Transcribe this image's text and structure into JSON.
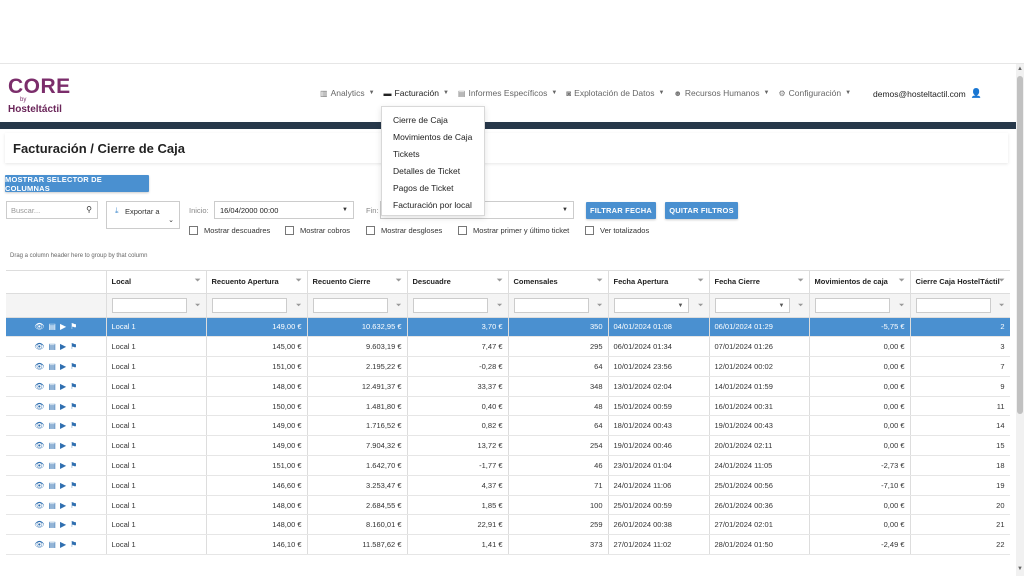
{
  "logo": {
    "line1": "CORE",
    "line2": "by",
    "line3": "Hosteltáctil"
  },
  "nav": [
    {
      "label": "Analytics",
      "icon": "chart-icon"
    },
    {
      "label": "Facturación",
      "icon": "card-icon"
    },
    {
      "label": "Informes Específicos",
      "icon": "report-icon"
    },
    {
      "label": "Explotación de Datos",
      "icon": "database-icon"
    },
    {
      "label": "Recursos Humanos",
      "icon": "users-icon"
    },
    {
      "label": "Configuración",
      "icon": "gear-icon"
    }
  ],
  "user": {
    "email": "demos@hosteltactil.com",
    "icon": "user-icon"
  },
  "dropdown": [
    "Cierre de Caja",
    "Movimientos de Caja",
    "Tickets",
    "Detalles de Ticket",
    "Pagos de Ticket",
    "Facturación por local"
  ],
  "page": {
    "title": "Facturación / Cierre de Caja"
  },
  "toolbar": {
    "columns_btn": "MOSTRAR SELECTOR DE COLUMNAS",
    "search_placeholder": "Buscar...",
    "export_label": "Exportar a",
    "inicio_label": "Inicio:",
    "inicio_value": "16/04/2000 00:00",
    "fin_label": "Fin:",
    "filter_btn": "FILTRAR FECHA",
    "clear_btn": "QUITAR FILTROS"
  },
  "checks": [
    "Mostrar descuadres",
    "Mostrar cobros",
    "Mostrar desgloses",
    "Mostrar primer y último ticket",
    "Ver totalizados"
  ],
  "drag_hint": "Drag a column header here to group by that column",
  "columns": [
    "Local",
    "Recuento Apertura",
    "Recuento Cierre",
    "Descuadre",
    "Comensales",
    "Fecha Apertura",
    "Fecha Cierre",
    "Movimientos de caja",
    "Cierre Caja HostelTáctil"
  ],
  "rows": [
    [
      "Local 1",
      "149,00 €",
      "10.632,95 €",
      "3,70 €",
      "350",
      "04/01/2024 01:08",
      "06/01/2024 01:29",
      "-5,75 €",
      "2"
    ],
    [
      "Local 1",
      "145,00 €",
      "9.603,19 €",
      "7,47 €",
      "295",
      "06/01/2024 01:34",
      "07/01/2024 01:26",
      "0,00 €",
      "3"
    ],
    [
      "Local 1",
      "151,00 €",
      "2.195,22 €",
      "-0,28 €",
      "64",
      "10/01/2024 23:56",
      "12/01/2024 00:02",
      "0,00 €",
      "7"
    ],
    [
      "Local 1",
      "148,00 €",
      "12.491,37 €",
      "33,37 €",
      "348",
      "13/01/2024 02:04",
      "14/01/2024 01:59",
      "0,00 €",
      "9"
    ],
    [
      "Local 1",
      "150,00 €",
      "1.481,80 €",
      "0,40 €",
      "48",
      "15/01/2024 00:59",
      "16/01/2024 00:31",
      "0,00 €",
      "11"
    ],
    [
      "Local 1",
      "149,00 €",
      "1.716,52 €",
      "0,82 €",
      "64",
      "18/01/2024 00:43",
      "19/01/2024 00:43",
      "0,00 €",
      "14"
    ],
    [
      "Local 1",
      "149,00 €",
      "7.904,32 €",
      "13,72 €",
      "254",
      "19/01/2024 00:46",
      "20/01/2024 02:11",
      "0,00 €",
      "15"
    ],
    [
      "Local 1",
      "151,00 €",
      "1.642,70 €",
      "-1,77 €",
      "46",
      "23/01/2024 01:04",
      "24/01/2024 11:05",
      "-2,73 €",
      "18"
    ],
    [
      "Local 1",
      "146,60 €",
      "3.253,47 €",
      "4,37 €",
      "71",
      "24/01/2024 11:06",
      "25/01/2024 00:56",
      "-7,10 €",
      "19"
    ],
    [
      "Local 1",
      "148,00 €",
      "2.684,55 €",
      "1,85 €",
      "100",
      "25/01/2024 00:59",
      "26/01/2024 00:36",
      "0,00 €",
      "20"
    ],
    [
      "Local 1",
      "148,00 €",
      "8.160,01 €",
      "22,91 €",
      "259",
      "26/01/2024 00:38",
      "27/01/2024 02:01",
      "0,00 €",
      "21"
    ],
    [
      "Local 1",
      "146,10 €",
      "11.587,62 €",
      "1,41 €",
      "373",
      "27/01/2024 11:02",
      "28/01/2024 01:50",
      "-2,49 €",
      "22"
    ]
  ],
  "row_icons": [
    "eye-icon",
    "document-icon",
    "video-icon",
    "cash-icon"
  ],
  "colors": {
    "accent": "#4a90d0",
    "darkbar": "#27384a",
    "brand": "#7b2d6b"
  }
}
